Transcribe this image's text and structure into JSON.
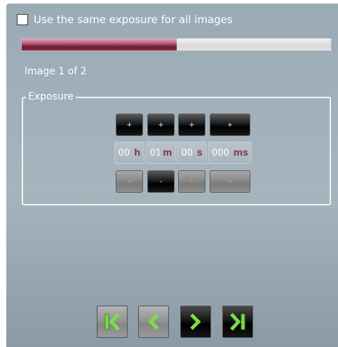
{
  "options": {
    "same_exposure_label": "Use the same exposure for all images",
    "same_exposure_checked": false
  },
  "progress": {
    "fraction": 0.5
  },
  "image_counter": "Image 1 of 2",
  "exposure": {
    "group_title": "Exposure",
    "plus_label": "+",
    "minus_label": "-",
    "fields": [
      {
        "value": "00",
        "unit": "h"
      },
      {
        "value": "01",
        "unit": "m"
      },
      {
        "value": "00",
        "unit": "s"
      },
      {
        "value": "000",
        "unit": "ms"
      }
    ]
  },
  "colors": {
    "accent": "#7a1f38",
    "unit_text": "#8a3c5a",
    "nav_arrow": "#7ddc4a"
  },
  "navigation": {
    "icons": [
      "first-icon",
      "previous-icon",
      "next-icon",
      "last-icon"
    ]
  }
}
